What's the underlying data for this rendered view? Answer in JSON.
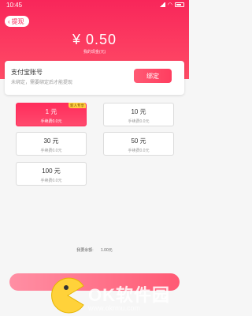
{
  "status_bar": {
    "time": "10:45",
    "icons": [
      "signal-icon",
      "wifi-icon",
      "battery-icon"
    ]
  },
  "header": {
    "back_label": "提现",
    "balance": "¥ 0.50",
    "balance_label": "我的现金(元)",
    "colors": {
      "primary": "#f8265a",
      "accent": "#ff4c66"
    }
  },
  "alipay": {
    "title": "支付宝账号",
    "subtitle": "未绑定，需要绑定后才能提现",
    "bind_label": "绑定"
  },
  "options": [
    {
      "amount": "1 元",
      "fee": "手续费0.0元",
      "selected": true,
      "tag": "新人专享"
    },
    {
      "amount": "10 元",
      "fee": "手续费0.0元",
      "selected": false
    },
    {
      "amount": "30 元",
      "fee": "手续费0.0元",
      "selected": false
    },
    {
      "amount": "50 元",
      "fee": "手续费0.0元",
      "selected": false
    },
    {
      "amount": "100 元",
      "fee": "手续费0.0元",
      "selected": false
    }
  ],
  "remaining": {
    "label": "我要余额:",
    "value": "1.00元"
  },
  "watermark": {
    "text": "OK软件园",
    "url": "www.okrmu.com"
  }
}
